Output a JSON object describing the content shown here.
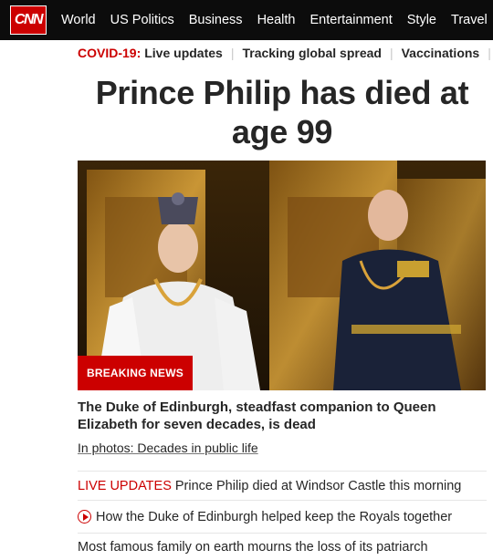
{
  "brand": {
    "logo_text": "CNN",
    "accent": "#cc0000",
    "nav_bg": "#0c0c0c"
  },
  "nav": [
    "World",
    "US Politics",
    "Business",
    "Health",
    "Entertainment",
    "Style",
    "Travel"
  ],
  "subnav": {
    "covid_label": "COVID-19:",
    "items": [
      "Live updates",
      "Tracking global spread",
      "Vaccinations"
    ]
  },
  "article": {
    "headline": "Prince Philip has died at age 99",
    "badge": "BREAKING NEWS",
    "subhead": "The Duke of Edinburgh, steadfast companion to Queen Elizabeth for seven decades, is dead",
    "photos_link": "In photos: Decades in public life"
  },
  "stories": [
    {
      "prefix": "LIVE UPDATES",
      "text": "Prince Philip died at Windsor Castle this morning",
      "icon": ""
    },
    {
      "prefix": "",
      "text": "How the Duke of Edinburgh helped keep the Royals together",
      "icon": "play-icon"
    },
    {
      "prefix": "",
      "text": "Most famous family on earth mourns the loss of its patriarch",
      "icon": ""
    }
  ]
}
